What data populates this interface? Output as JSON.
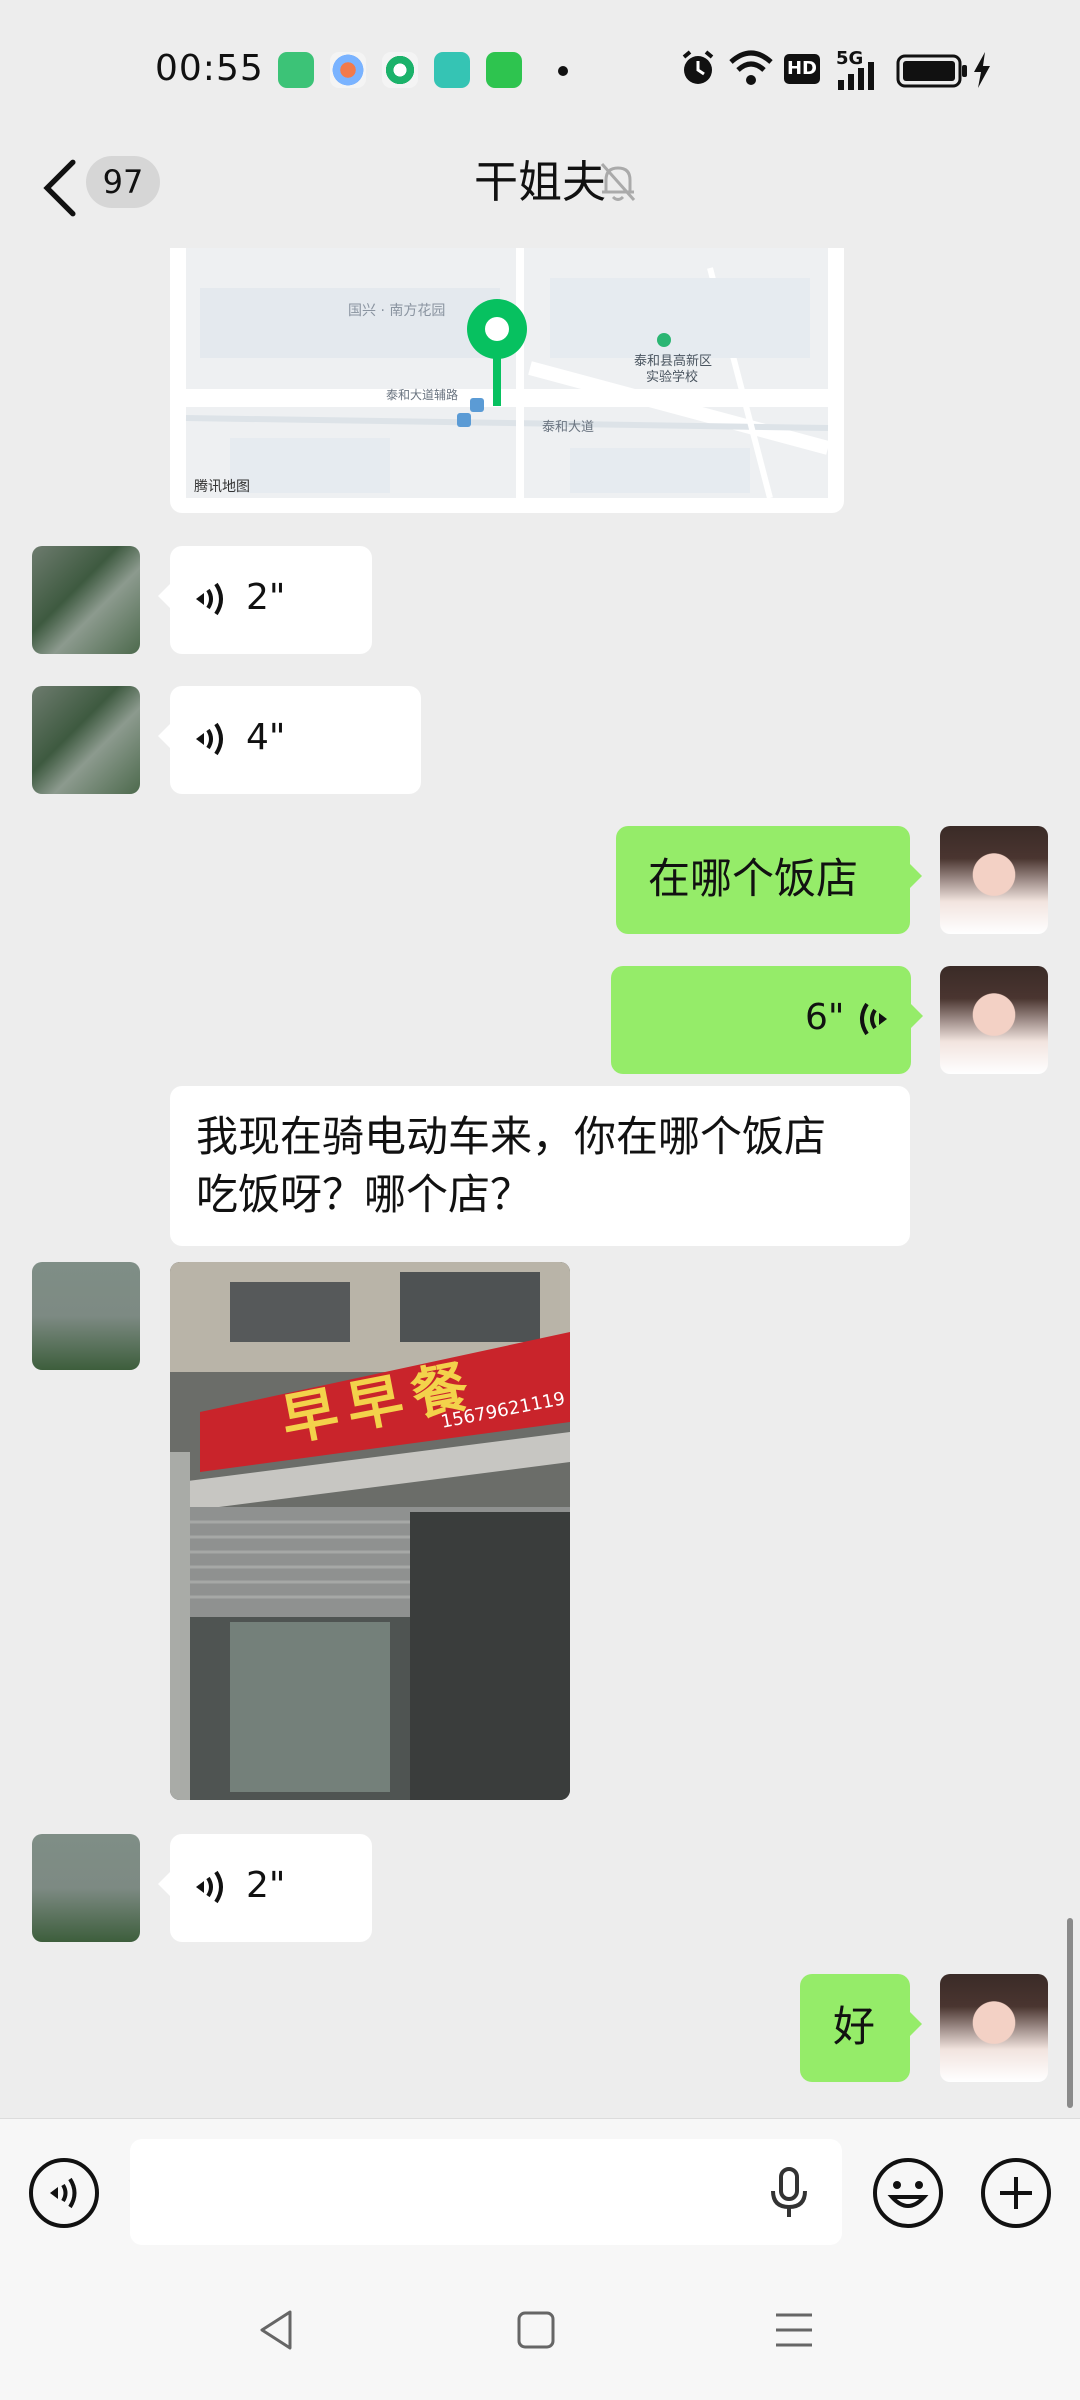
{
  "status": {
    "time": "00:55",
    "network": "5G",
    "hd_label": "HD"
  },
  "chat": {
    "unread_count": "97",
    "title": "干姐夫"
  },
  "map": {
    "label_community": "国兴 · 南方花园",
    "label_school": "泰和县高新区",
    "label_school2": "实验学校",
    "label_road1": "泰和大道辅路",
    "label_road2": "泰和大道",
    "attribution": "腾讯地图"
  },
  "messages": {
    "voice1": {
      "duration": "2\""
    },
    "voice2": {
      "duration": "4\""
    },
    "text_me1": "在哪个饭店",
    "voice_me": {
      "duration": "6\""
    },
    "text_other_line1": "我现在骑电动车来，你在哪个饭店",
    "text_other_line2": "吃饭呀？哪个店？",
    "photo": {
      "sign_text": "早早餐",
      "phone_text": "15679621119"
    },
    "voice3": {
      "duration": "2\""
    },
    "text_me2": "好"
  },
  "icons": [
    "back-chevron-icon",
    "mute-bell-icon",
    "voice-wave-icon",
    "microphone-icon",
    "emoji-icon",
    "add-icon",
    "nav-back-icon",
    "nav-home-icon",
    "nav-menu-icon"
  ]
}
